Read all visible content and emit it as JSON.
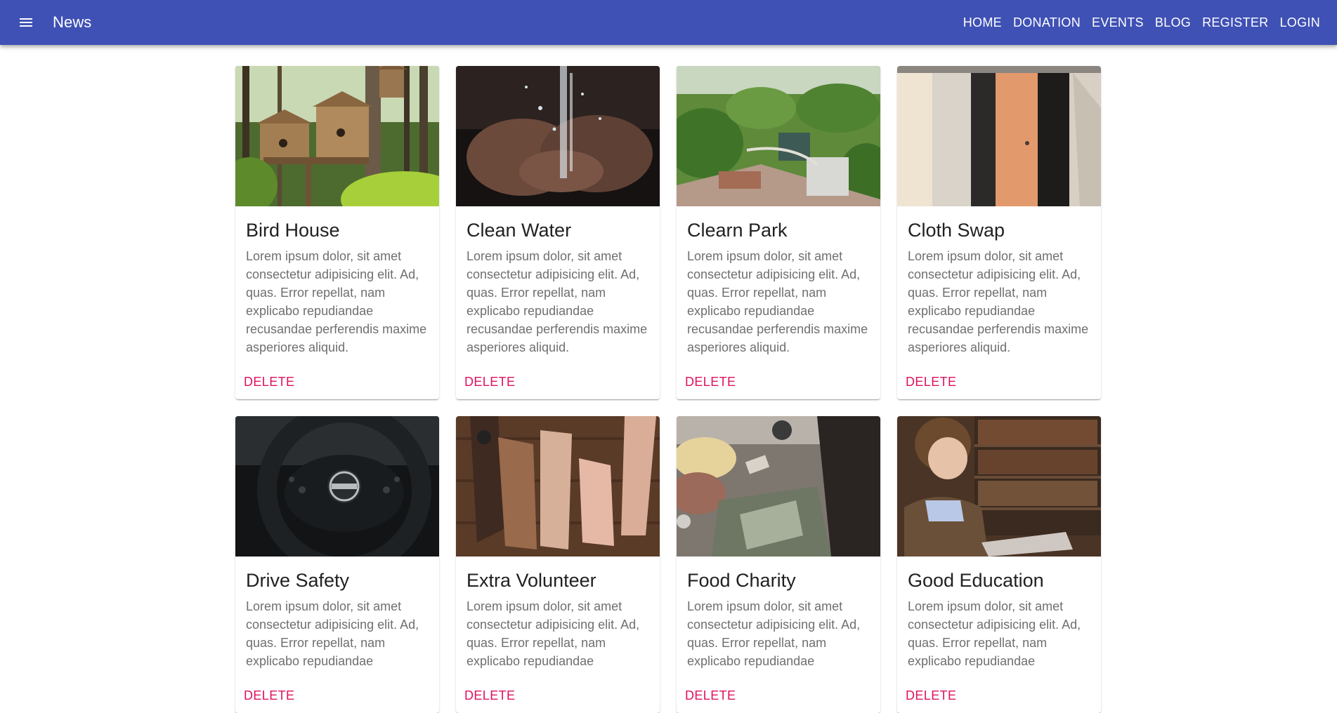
{
  "header": {
    "title": "News",
    "menu_icon": "menu-icon",
    "nav": [
      "HOME",
      "DONATION",
      "EVENTS",
      "BLOG",
      "REGISTER",
      "LOGIN"
    ],
    "background_color": "#3f51b5"
  },
  "cards": [
    {
      "title": "Bird House",
      "body": "Lorem ipsum dolor, sit amet consectetur adipisicing elit. Ad, quas. Error repellat, nam explicabo repudiandae recusandae perferendis maxime asperiores aliquid.",
      "action": "DELETE"
    },
    {
      "title": "Clean Water",
      "body": "Lorem ipsum dolor, sit amet consectetur adipisicing elit. Ad, quas. Error repellat, nam explicabo repudiandae recusandae perferendis maxime asperiores aliquid.",
      "action": "DELETE"
    },
    {
      "title": "Clearn Park",
      "body": "Lorem ipsum dolor, sit amet consectetur adipisicing elit. Ad, quas. Error repellat, nam explicabo repudiandae recusandae perferendis maxime asperiores aliquid.",
      "action": "DELETE"
    },
    {
      "title": "Cloth Swap",
      "body": "Lorem ipsum dolor, sit amet consectetur adipisicing elit. Ad, quas. Error repellat, nam explicabo repudiandae recusandae perferendis maxime asperiores aliquid.",
      "action": "DELETE"
    },
    {
      "title": "Drive Safety",
      "body": "Lorem ipsum dolor, sit amet consectetur adipisicing elit. Ad, quas. Error repellat, nam explicabo repudiandae",
      "action": "DELETE"
    },
    {
      "title": "Extra Volunteer",
      "body": "Lorem ipsum dolor, sit amet consectetur adipisicing elit. Ad, quas. Error repellat, nam explicabo repudiandae",
      "action": "DELETE"
    },
    {
      "title": "Food Charity",
      "body": "Lorem ipsum dolor, sit amet consectetur adipisicing elit. Ad, quas. Error repellat, nam explicabo repudiandae",
      "action": "DELETE"
    },
    {
      "title": "Good Education",
      "body": "Lorem ipsum dolor, sit amet consectetur adipisicing elit. Ad, quas. Error repellat, nam explicabo repudiandae",
      "action": "DELETE"
    }
  ],
  "colors": {
    "accent": "#e0115f",
    "title_text": "#212121",
    "body_text": "#6f6f6f"
  }
}
